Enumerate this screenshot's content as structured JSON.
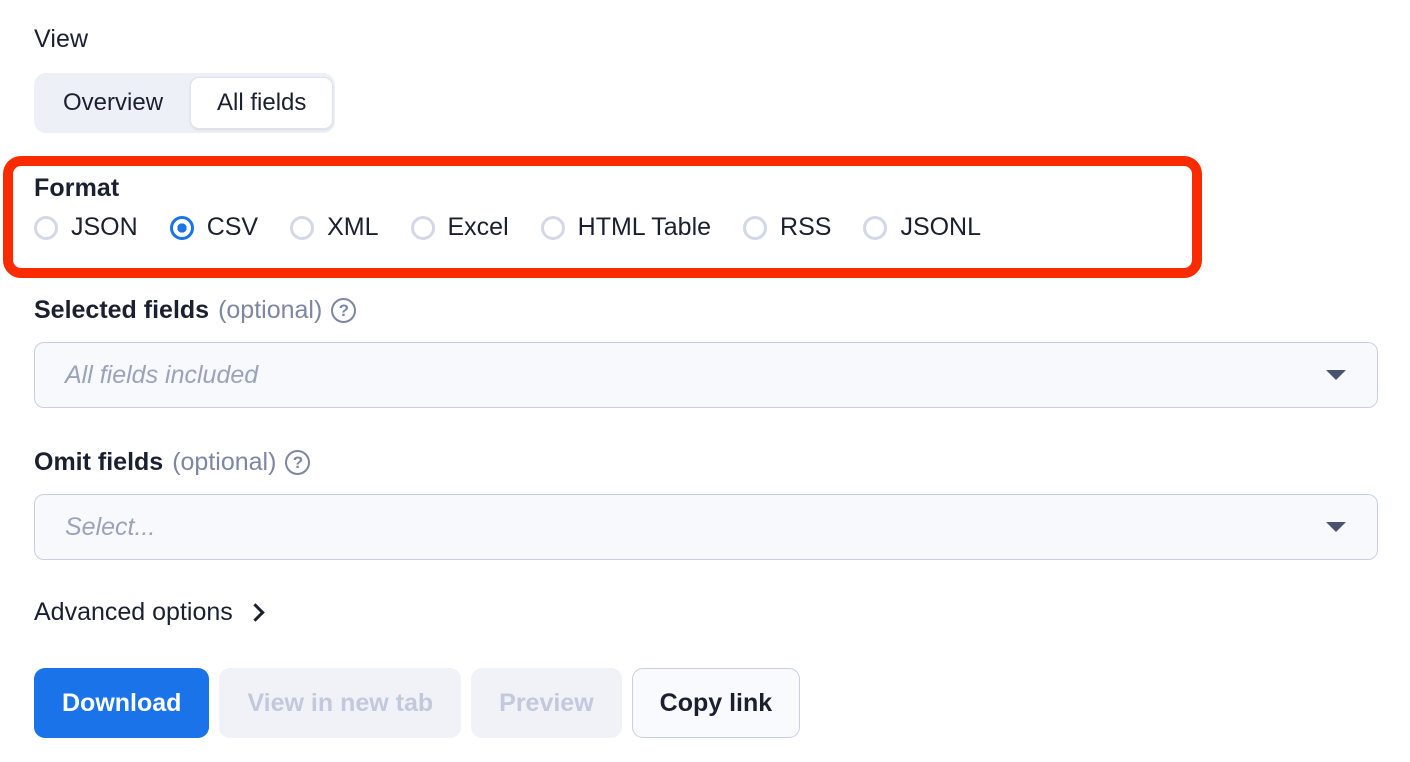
{
  "view": {
    "label": "View",
    "options": [
      {
        "label": "Overview",
        "selected": false
      },
      {
        "label": "All fields",
        "selected": true
      }
    ]
  },
  "format": {
    "label": "Format",
    "selected": "CSV",
    "options": [
      {
        "label": "JSON"
      },
      {
        "label": "CSV"
      },
      {
        "label": "XML"
      },
      {
        "label": "Excel"
      },
      {
        "label": "HTML Table"
      },
      {
        "label": "RSS"
      },
      {
        "label": "JSONL"
      }
    ],
    "highlight_color": "#fb2b00"
  },
  "selected_fields": {
    "label": "Selected fields",
    "optional_label": "(optional)",
    "help_icon": "help-circle-icon",
    "help_glyph": "?",
    "placeholder": "All fields included"
  },
  "omit_fields": {
    "label": "Omit fields",
    "optional_label": "(optional)",
    "help_icon": "help-circle-icon",
    "help_glyph": "?",
    "placeholder": "Select..."
  },
  "advanced": {
    "label": "Advanced options",
    "icon": "chevron-right-icon"
  },
  "actions": {
    "download": {
      "label": "Download",
      "state": "enabled",
      "accent": "#1a73e8"
    },
    "view_in_new_tab": {
      "label": "View in new tab",
      "state": "disabled"
    },
    "preview": {
      "label": "Preview",
      "state": "disabled"
    },
    "copy_link": {
      "label": "Copy link",
      "state": "enabled"
    }
  }
}
